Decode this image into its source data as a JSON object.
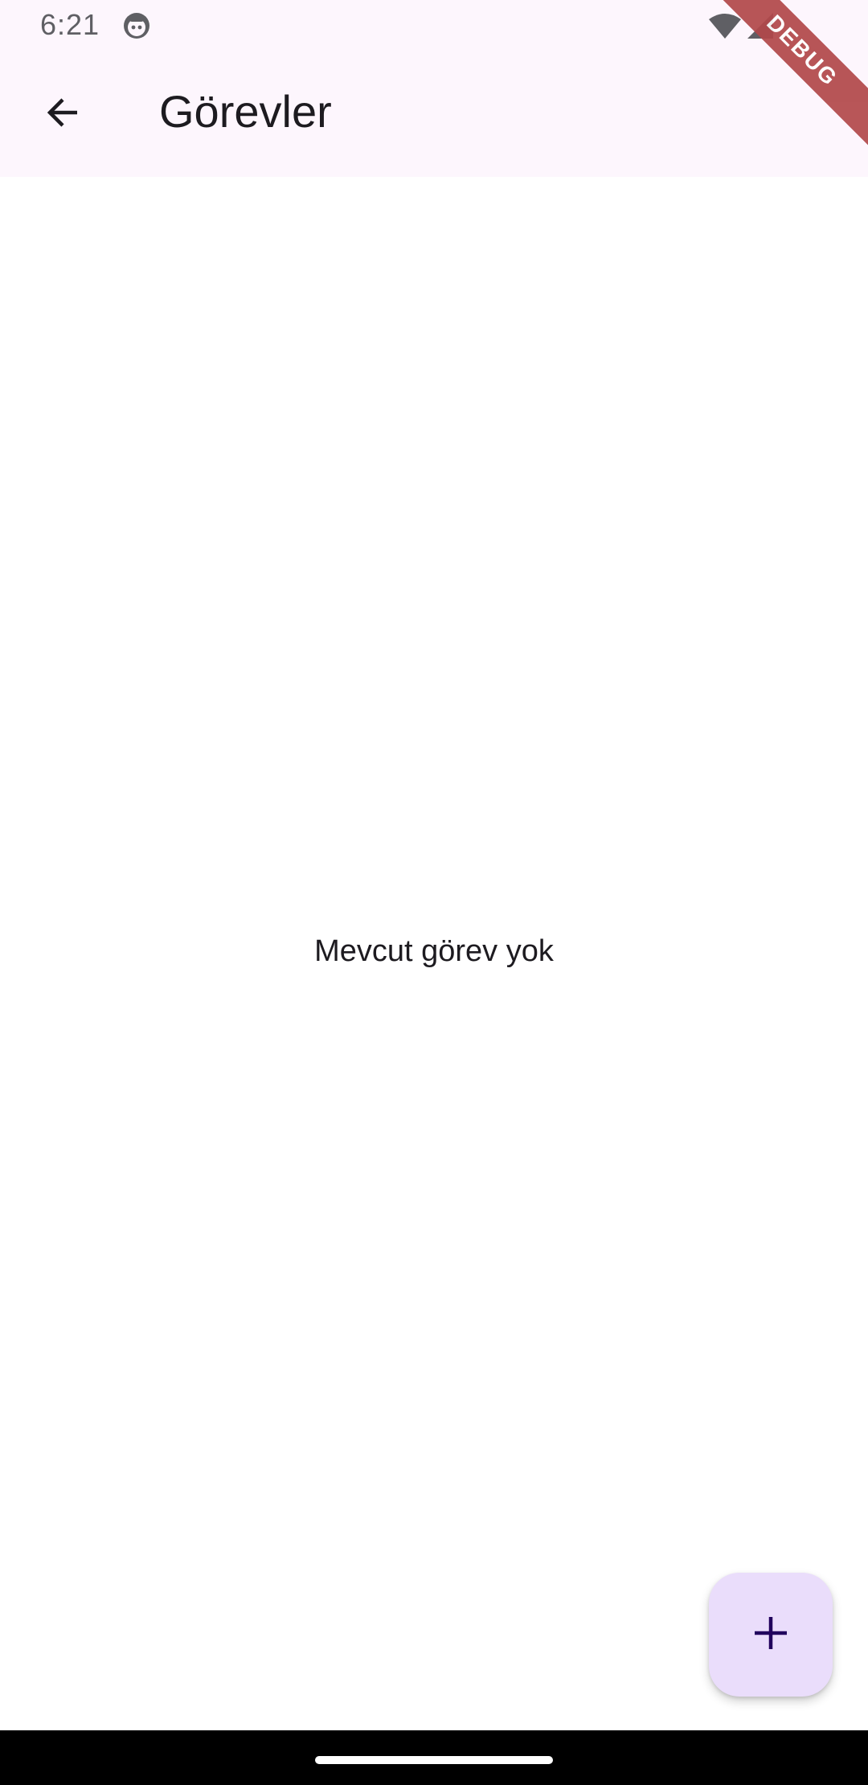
{
  "status_bar": {
    "time": "6:21",
    "icons": [
      "app-notification-icon",
      "wifi-icon",
      "cell-signal-icon"
    ]
  },
  "app_bar": {
    "back_icon": "arrow-back-icon",
    "title": "Görevler"
  },
  "debug_banner": {
    "label": "DEBUG",
    "color": "#b2484a"
  },
  "main": {
    "empty_message": "Mevcut görev yok"
  },
  "fab": {
    "icon": "plus-icon",
    "background": "#eaddfb",
    "icon_color": "#21005d"
  },
  "colors": {
    "app_bar_background": "#fdf6fd",
    "text_primary": "#1d1b20"
  }
}
